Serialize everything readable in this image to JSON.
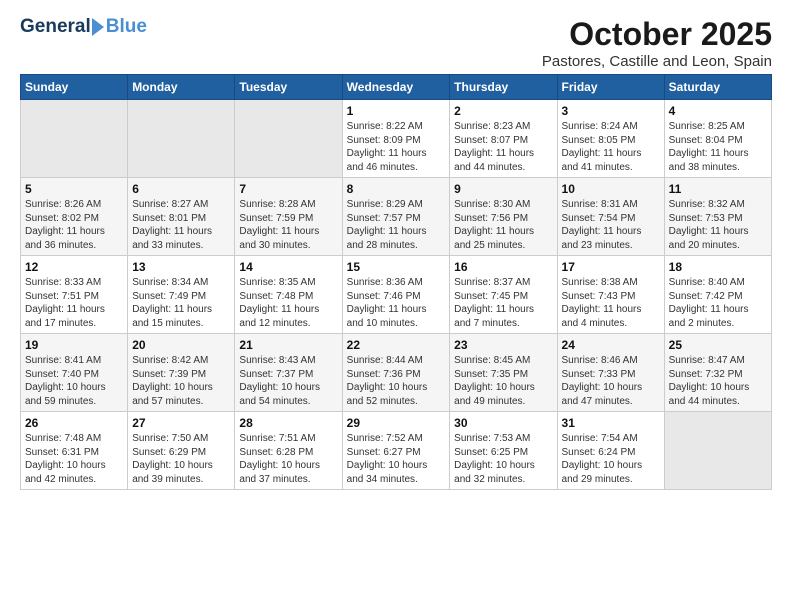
{
  "logo": {
    "word1": "General",
    "word2": "Blue"
  },
  "title": "October 2025",
  "subtitle": "Pastores, Castille and Leon, Spain",
  "days_of_week": [
    "Sunday",
    "Monday",
    "Tuesday",
    "Wednesday",
    "Thursday",
    "Friday",
    "Saturday"
  ],
  "weeks": [
    [
      {
        "num": "",
        "info": ""
      },
      {
        "num": "",
        "info": ""
      },
      {
        "num": "",
        "info": ""
      },
      {
        "num": "1",
        "info": "Sunrise: 8:22 AM\nSunset: 8:09 PM\nDaylight: 11 hours and 46 minutes."
      },
      {
        "num": "2",
        "info": "Sunrise: 8:23 AM\nSunset: 8:07 PM\nDaylight: 11 hours and 44 minutes."
      },
      {
        "num": "3",
        "info": "Sunrise: 8:24 AM\nSunset: 8:05 PM\nDaylight: 11 hours and 41 minutes."
      },
      {
        "num": "4",
        "info": "Sunrise: 8:25 AM\nSunset: 8:04 PM\nDaylight: 11 hours and 38 minutes."
      }
    ],
    [
      {
        "num": "5",
        "info": "Sunrise: 8:26 AM\nSunset: 8:02 PM\nDaylight: 11 hours and 36 minutes."
      },
      {
        "num": "6",
        "info": "Sunrise: 8:27 AM\nSunset: 8:01 PM\nDaylight: 11 hours and 33 minutes."
      },
      {
        "num": "7",
        "info": "Sunrise: 8:28 AM\nSunset: 7:59 PM\nDaylight: 11 hours and 30 minutes."
      },
      {
        "num": "8",
        "info": "Sunrise: 8:29 AM\nSunset: 7:57 PM\nDaylight: 11 hours and 28 minutes."
      },
      {
        "num": "9",
        "info": "Sunrise: 8:30 AM\nSunset: 7:56 PM\nDaylight: 11 hours and 25 minutes."
      },
      {
        "num": "10",
        "info": "Sunrise: 8:31 AM\nSunset: 7:54 PM\nDaylight: 11 hours and 23 minutes."
      },
      {
        "num": "11",
        "info": "Sunrise: 8:32 AM\nSunset: 7:53 PM\nDaylight: 11 hours and 20 minutes."
      }
    ],
    [
      {
        "num": "12",
        "info": "Sunrise: 8:33 AM\nSunset: 7:51 PM\nDaylight: 11 hours and 17 minutes."
      },
      {
        "num": "13",
        "info": "Sunrise: 8:34 AM\nSunset: 7:49 PM\nDaylight: 11 hours and 15 minutes."
      },
      {
        "num": "14",
        "info": "Sunrise: 8:35 AM\nSunset: 7:48 PM\nDaylight: 11 hours and 12 minutes."
      },
      {
        "num": "15",
        "info": "Sunrise: 8:36 AM\nSunset: 7:46 PM\nDaylight: 11 hours and 10 minutes."
      },
      {
        "num": "16",
        "info": "Sunrise: 8:37 AM\nSunset: 7:45 PM\nDaylight: 11 hours and 7 minutes."
      },
      {
        "num": "17",
        "info": "Sunrise: 8:38 AM\nSunset: 7:43 PM\nDaylight: 11 hours and 4 minutes."
      },
      {
        "num": "18",
        "info": "Sunrise: 8:40 AM\nSunset: 7:42 PM\nDaylight: 11 hours and 2 minutes."
      }
    ],
    [
      {
        "num": "19",
        "info": "Sunrise: 8:41 AM\nSunset: 7:40 PM\nDaylight: 10 hours and 59 minutes."
      },
      {
        "num": "20",
        "info": "Sunrise: 8:42 AM\nSunset: 7:39 PM\nDaylight: 10 hours and 57 minutes."
      },
      {
        "num": "21",
        "info": "Sunrise: 8:43 AM\nSunset: 7:37 PM\nDaylight: 10 hours and 54 minutes."
      },
      {
        "num": "22",
        "info": "Sunrise: 8:44 AM\nSunset: 7:36 PM\nDaylight: 10 hours and 52 minutes."
      },
      {
        "num": "23",
        "info": "Sunrise: 8:45 AM\nSunset: 7:35 PM\nDaylight: 10 hours and 49 minutes."
      },
      {
        "num": "24",
        "info": "Sunrise: 8:46 AM\nSunset: 7:33 PM\nDaylight: 10 hours and 47 minutes."
      },
      {
        "num": "25",
        "info": "Sunrise: 8:47 AM\nSunset: 7:32 PM\nDaylight: 10 hours and 44 minutes."
      }
    ],
    [
      {
        "num": "26",
        "info": "Sunrise: 7:48 AM\nSunset: 6:31 PM\nDaylight: 10 hours and 42 minutes."
      },
      {
        "num": "27",
        "info": "Sunrise: 7:50 AM\nSunset: 6:29 PM\nDaylight: 10 hours and 39 minutes."
      },
      {
        "num": "28",
        "info": "Sunrise: 7:51 AM\nSunset: 6:28 PM\nDaylight: 10 hours and 37 minutes."
      },
      {
        "num": "29",
        "info": "Sunrise: 7:52 AM\nSunset: 6:27 PM\nDaylight: 10 hours and 34 minutes."
      },
      {
        "num": "30",
        "info": "Sunrise: 7:53 AM\nSunset: 6:25 PM\nDaylight: 10 hours and 32 minutes."
      },
      {
        "num": "31",
        "info": "Sunrise: 7:54 AM\nSunset: 6:24 PM\nDaylight: 10 hours and 29 minutes."
      },
      {
        "num": "",
        "info": ""
      }
    ]
  ]
}
